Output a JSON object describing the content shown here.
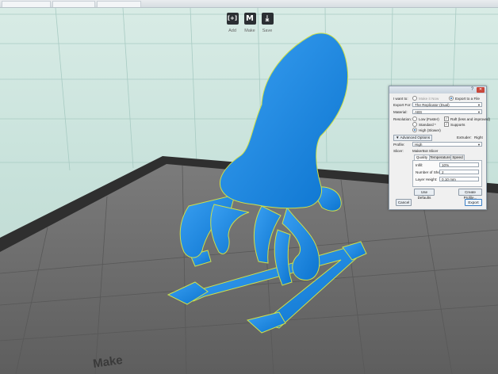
{
  "toolbar": {
    "items": [
      {
        "icon": "add-object-icon",
        "glyph": "[+]",
        "label": "Add"
      },
      {
        "icon": "makerbot-logo-icon",
        "glyph": "M",
        "label": "Make"
      },
      {
        "icon": "export-icon",
        "glyph": "⤓",
        "label": "Save"
      }
    ]
  },
  "export_dialog": {
    "help_glyph": "?",
    "close_glyph": "✕",
    "want_to_label": "I want to:",
    "make_it_now": "Make it Now",
    "export_to_file": "Export to a File",
    "export_for_label": "Export For:",
    "export_for_value": "The Replicator (Dual)",
    "material_label": "Material:",
    "material_value": "ABS",
    "resolution_label": "Resolution:",
    "resolution_low": "Low (Faster)",
    "resolution_standard": "Standard *",
    "resolution_high": "High (Slower)",
    "raft_label": "Raft (less and improved)",
    "supports_label": "Supports",
    "advanced_options": "Advanced Options",
    "extruder_label": "Extruder:",
    "extruder_value": "Right",
    "profile_label": "Profile:",
    "profile_value": "High",
    "slicer_label": "Slicer:",
    "slicer_value": "MakerBot Slicer",
    "tabs": [
      "Quality",
      "Temperature",
      "Speed"
    ],
    "infill_label": "Infill:",
    "infill_value": "10%",
    "shells_label": "Number of Shells:",
    "shells_value": "2",
    "layer_height_label": "Layer Height:",
    "layer_height_value": "0.10 mm",
    "use_defaults": "Use Defaults",
    "create_profile": "Create Profile...",
    "cancel": "Cancel",
    "export": "Export"
  },
  "platform_label": "Make",
  "colors": {
    "model": "#1d8fe6",
    "model_outline": "#cde04a",
    "platform": "#6b6b6b",
    "platform_frame": "#2f2f2f",
    "background": "#cde6df",
    "grid": "#a4c7bf"
  }
}
